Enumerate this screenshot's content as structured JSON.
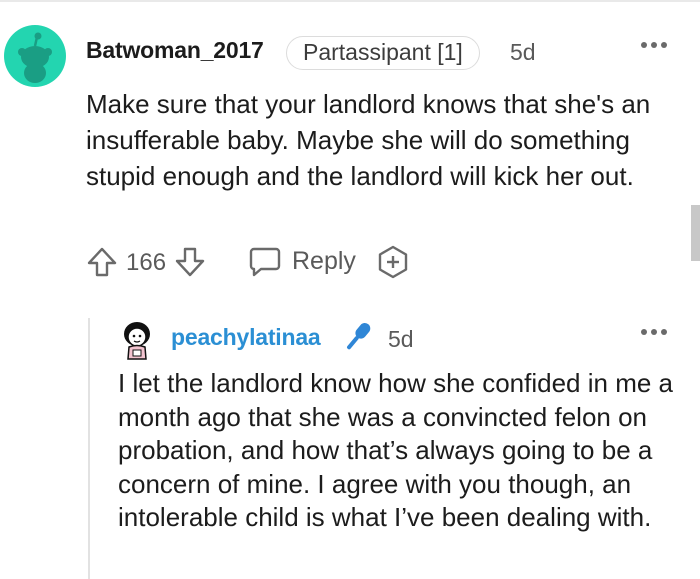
{
  "comment": {
    "username": "Batwoman_2017",
    "flair": "Partassipant [1]",
    "time": "5d",
    "body": "Make sure that your landlord knows that she's an insufferable baby. Maybe she will do something stupid enough and the landlord will kick her out.",
    "score": "166",
    "reply_label": "Reply",
    "avatar_color": "#23d5b0"
  },
  "reply": {
    "username": "peachylatinaa",
    "time": "5d",
    "body": "I let the landlord know how she confided in me a month ago that she was a convincted felon on probation, and how that’s always going to be a concern of mine. I agree with you though, an intolerable child is what I’ve been dealing with.",
    "username_color": "#2b8fd4",
    "badge_icon": "microphone-icon",
    "badge_color": "#2f86d6"
  }
}
